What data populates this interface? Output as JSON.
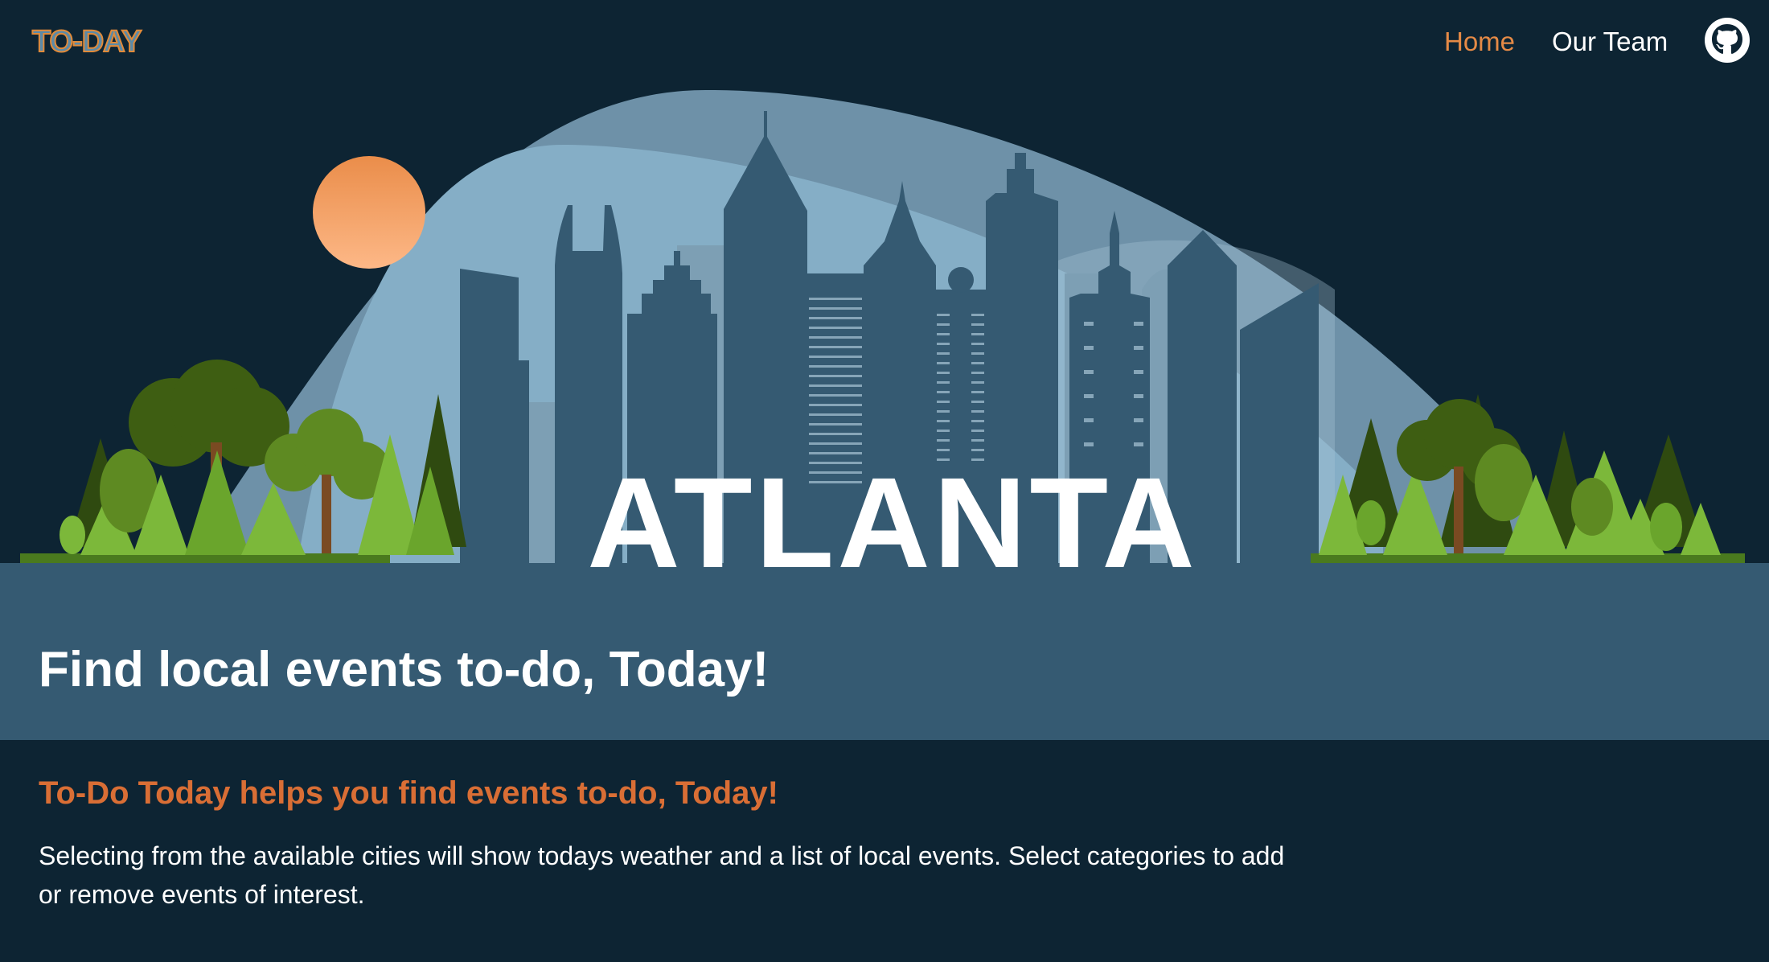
{
  "nav": {
    "logo_text": "TO-DAY",
    "links": [
      {
        "label": "Home",
        "active": true
      },
      {
        "label": "Our Team",
        "active": false
      }
    ],
    "github_icon": "github-icon"
  },
  "hero": {
    "city": "ATLANTA",
    "tagline": "Find local events to-do, Today!"
  },
  "intro": {
    "heading": "To-Do Today helps you find events to-do, Today!",
    "body": "Selecting from the available cities will show todays weather and a list of local events. Select categories to add or remove events of interest."
  },
  "colors": {
    "background": "#0d2433",
    "banner": "#355a72",
    "accent": "#e58a46",
    "heading_orange": "#d96e35"
  }
}
